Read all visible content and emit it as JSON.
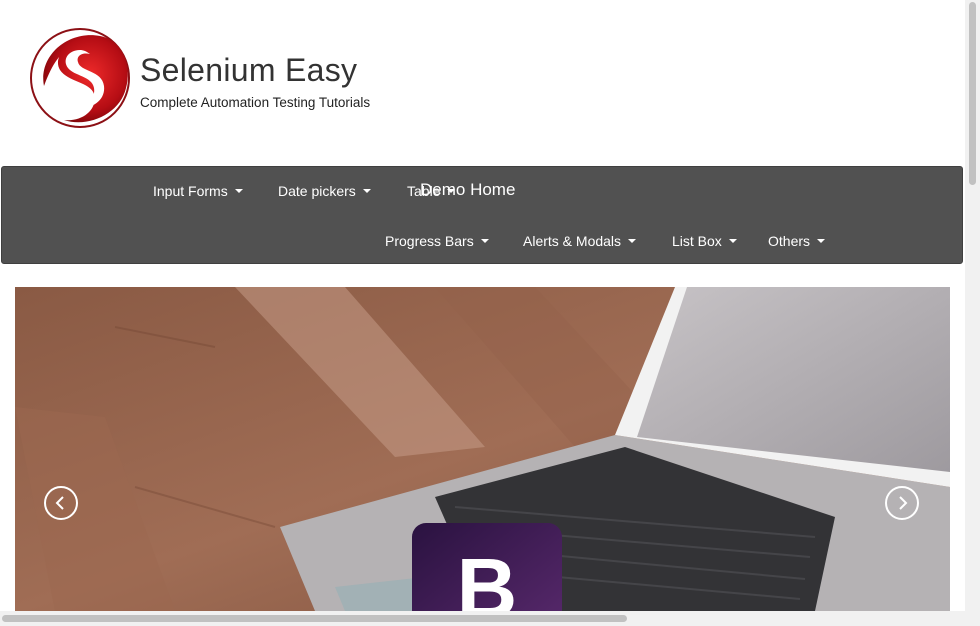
{
  "header": {
    "title": "Selenium Easy",
    "subtitle": "Complete Automation Testing Tutorials",
    "logo_icon": "selenium-easy-logo"
  },
  "navbar": {
    "row1": [
      {
        "label": "Input Forms"
      },
      {
        "label": "Date pickers"
      },
      {
        "label": "Table"
      }
    ],
    "demo_home": "Demo Home",
    "row2": [
      {
        "label": "Progress Bars"
      },
      {
        "label": "Alerts & Modals"
      },
      {
        "label": "List Box"
      },
      {
        "label": "Others"
      }
    ]
  },
  "carousel": {
    "prev_icon": "chevron-left-icon",
    "next_icon": "chevron-right-icon",
    "badge_letter": "B"
  },
  "colors": {
    "navbar_bg": "#515151",
    "brand_red": "#c8141e",
    "badge_purple": "#563d7c"
  }
}
